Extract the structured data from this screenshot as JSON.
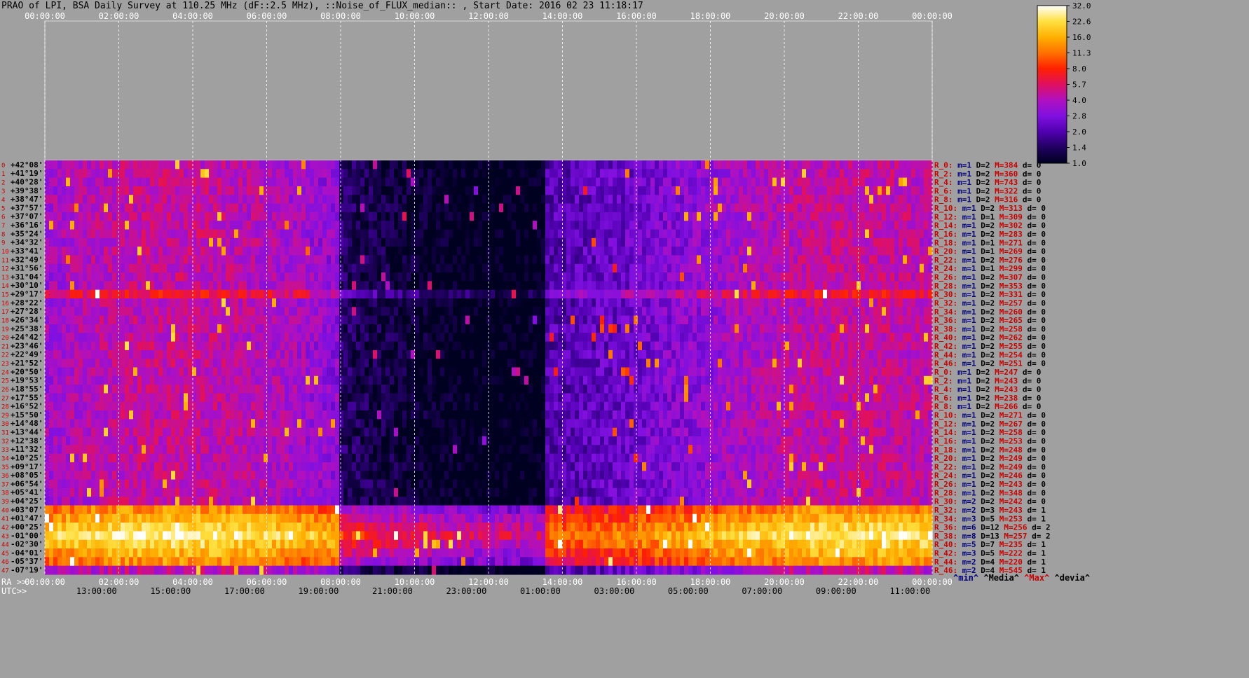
{
  "title": "PRAO of LPI, BSA Daily Survey at 110.25 MHz (dF::2.5 MHz), ::Noise_of_FLUX_median:: , Start Date: 2016 02 23 11:18:17",
  "chart_data": {
    "type": "heatmap",
    "top_axis_ticks": [
      "00:00:00",
      "02:00:00",
      "04:00:00",
      "06:00:00",
      "08:00:00",
      "10:00:00",
      "12:00:00",
      "14:00:00",
      "16:00:00",
      "18:00:00",
      "20:00:00",
      "22:00:00",
      "00:00:00"
    ],
    "ra_prefix": "RA >>",
    "ra_ticks": [
      "00:00:00",
      "02:00:00",
      "04:00:00",
      "06:00:00",
      "08:00:00",
      "10:00:00",
      "12:00:00",
      "14:00:00",
      "16:00:00",
      "18:00:00",
      "20:00:00",
      "22:00:00",
      "00:00:00"
    ],
    "utc_prefix": "UTC>>",
    "utc_ticks": [
      "13:00:00",
      "15:00:00",
      "17:00:00",
      "19:00:00",
      "21:00:00",
      "23:00:00",
      "01:00:00",
      "03:00:00",
      "05:00:00",
      "07:00:00",
      "09:00:00",
      "11:00:00"
    ],
    "declinations": [
      "+42°08'",
      "+41°19'",
      "+40°28'",
      "+39°38'",
      "+38°47'",
      "+37°57'",
      "+37°07'",
      "+36°16'",
      "+35°24'",
      "+34°32'",
      "+33°41'",
      "+32°49'",
      "+31°56'",
      "+31°04'",
      "+30°10'",
      "+29°17'",
      "+28°22'",
      "+27°28'",
      "+26°34'",
      "+25°38'",
      "+24°42'",
      "+23°46'",
      "+22°49'",
      "+21°52'",
      "+20°50'",
      "+19°53'",
      "+18°55'",
      "+17°55'",
      "+16°52'",
      "+15°50'",
      "+14°48'",
      "+13°44'",
      "+12°38'",
      "+11°32'",
      "+10°25'",
      "+09°17'",
      "+08°05'",
      "+06°54'",
      "+05°41'",
      "+04°25'",
      "+03°07'",
      "+01°47'",
      "+00°25'",
      "-01°00'",
      "-02°30'",
      "-04°01'",
      "-05°37'",
      "-07°19'"
    ],
    "row_stats": [
      {
        "r": "R_0:",
        "m": "m=1",
        "d": "D=2",
        "M": "M=384",
        "dv": "d= 0"
      },
      {
        "r": "R_2:",
        "m": "m=1",
        "d": "D=2",
        "M": "M=360",
        "dv": "d= 0"
      },
      {
        "r": "R_4:",
        "m": "m=1",
        "d": "D=2",
        "M": "M=743",
        "dv": "d= 0"
      },
      {
        "r": "R_6:",
        "m": "m=1",
        "d": "D=2",
        "M": "M=322",
        "dv": "d= 0"
      },
      {
        "r": "R_8:",
        "m": "m=1",
        "d": "D=2",
        "M": "M=316",
        "dv": "d= 0"
      },
      {
        "r": "R_10:",
        "m": "m=1",
        "d": "D=2",
        "M": "M=313",
        "dv": "d= 0"
      },
      {
        "r": "R_12:",
        "m": "m=1",
        "d": "D=1",
        "M": "M=309",
        "dv": "d= 0"
      },
      {
        "r": "R_14:",
        "m": "m=1",
        "d": "D=2",
        "M": "M=302",
        "dv": "d= 0"
      },
      {
        "r": "R_16:",
        "m": "m=1",
        "d": "D=2",
        "M": "M=283",
        "dv": "d= 0"
      },
      {
        "r": "R_18:",
        "m": "m=1",
        "d": "D=1",
        "M": "M=271",
        "dv": "d= 0"
      },
      {
        "r": "R_20:",
        "m": "m=1",
        "d": "D=1",
        "M": "M=269",
        "dv": "d= 0"
      },
      {
        "r": "R_22:",
        "m": "m=1",
        "d": "D=2",
        "M": "M=276",
        "dv": "d= 0"
      },
      {
        "r": "R_24:",
        "m": "m=1",
        "d": "D=1",
        "M": "M=299",
        "dv": "d= 0"
      },
      {
        "r": "R_26:",
        "m": "m=1",
        "d": "D=2",
        "M": "M=307",
        "dv": "d= 0"
      },
      {
        "r": "R_28:",
        "m": "m=1",
        "d": "D=2",
        "M": "M=353",
        "dv": "d= 0"
      },
      {
        "r": "R_30:",
        "m": "m=1",
        "d": "D=2",
        "M": "M=331",
        "dv": "d= 0"
      },
      {
        "r": "R_32:",
        "m": "m=1",
        "d": "D=2",
        "M": "M=257",
        "dv": "d= 0"
      },
      {
        "r": "R_34:",
        "m": "m=1",
        "d": "D=2",
        "M": "M=260",
        "dv": "d= 0"
      },
      {
        "r": "R_36:",
        "m": "m=1",
        "d": "D=2",
        "M": "M=265",
        "dv": "d= 0"
      },
      {
        "r": "R_38:",
        "m": "m=1",
        "d": "D=2",
        "M": "M=258",
        "dv": "d= 0"
      },
      {
        "r": "R_40:",
        "m": "m=1",
        "d": "D=2",
        "M": "M=262",
        "dv": "d= 0"
      },
      {
        "r": "R_42:",
        "m": "m=1",
        "d": "D=2",
        "M": "M=255",
        "dv": "d= 0"
      },
      {
        "r": "R_44:",
        "m": "m=1",
        "d": "D=2",
        "M": "M=254",
        "dv": "d= 0"
      },
      {
        "r": "R_46:",
        "m": "m=1",
        "d": "D=2",
        "M": "M=251",
        "dv": "d= 0"
      },
      {
        "r": "R_0:",
        "m": "m=1",
        "d": "D=2",
        "M": "M=247",
        "dv": "d= 0"
      },
      {
        "r": "R_2:",
        "m": "m=1",
        "d": "D=2",
        "M": "M=243",
        "dv": "d= 0"
      },
      {
        "r": "R_4:",
        "m": "m=1",
        "d": "D=2",
        "M": "M=243",
        "dv": "d= 0"
      },
      {
        "r": "R_6:",
        "m": "m=1",
        "d": "D=2",
        "M": "M=238",
        "dv": "d= 0"
      },
      {
        "r": "R_8:",
        "m": "m=1",
        "d": "D=2",
        "M": "M=266",
        "dv": "d= 0"
      },
      {
        "r": "R_10:",
        "m": "m=1",
        "d": "D=2",
        "M": "M=271",
        "dv": "d= 0"
      },
      {
        "r": "R_12:",
        "m": "m=1",
        "d": "D=2",
        "M": "M=267",
        "dv": "d= 0"
      },
      {
        "r": "R_14:",
        "m": "m=1",
        "d": "D=2",
        "M": "M=258",
        "dv": "d= 0"
      },
      {
        "r": "R_16:",
        "m": "m=1",
        "d": "D=2",
        "M": "M=253",
        "dv": "d= 0"
      },
      {
        "r": "R_18:",
        "m": "m=1",
        "d": "D=2",
        "M": "M=248",
        "dv": "d= 0"
      },
      {
        "r": "R_20:",
        "m": "m=1",
        "d": "D=2",
        "M": "M=249",
        "dv": "d= 0"
      },
      {
        "r": "R_22:",
        "m": "m=1",
        "d": "D=2",
        "M": "M=249",
        "dv": "d= 0"
      },
      {
        "r": "R_24:",
        "m": "m=1",
        "d": "D=2",
        "M": "M=246",
        "dv": "d= 0"
      },
      {
        "r": "R_26:",
        "m": "m=1",
        "d": "D=2",
        "M": "M=243",
        "dv": "d= 0"
      },
      {
        "r": "R_28:",
        "m": "m=1",
        "d": "D=2",
        "M": "M=348",
        "dv": "d= 0"
      },
      {
        "r": "R_30:",
        "m": "m=2",
        "d": "D=2",
        "M": "M=242",
        "dv": "d= 0"
      },
      {
        "r": "R_32:",
        "m": "m=2",
        "d": "D=3",
        "M": "M=243",
        "dv": "d= 1"
      },
      {
        "r": "R_34:",
        "m": "m=3",
        "d": "D=5",
        "M": "M=253",
        "dv": "d= 1"
      },
      {
        "r": "R_36:",
        "m": "m=6",
        "d": "D=12",
        "M": "M=256",
        "dv": "d= 2"
      },
      {
        "r": "R_38:",
        "m": "m=8",
        "d": "D=13",
        "M": "M=257",
        "dv": "d= 2"
      },
      {
        "r": "R_40:",
        "m": "m=5",
        "d": "D=7",
        "M": "M=235",
        "dv": "d= 1"
      },
      {
        "r": "R_42:",
        "m": "m=3",
        "d": "D=5",
        "M": "M=222",
        "dv": "d= 1"
      },
      {
        "r": "R_44:",
        "m": "m=2",
        "d": "D=4",
        "M": "M=220",
        "dv": "d= 1"
      },
      {
        "r": "R_46:",
        "m": "m=2",
        "d": "D=4",
        "M": "M=545",
        "dv": "d= 1"
      }
    ],
    "stats_legend": {
      "min": "^min^",
      "median": "^Media^",
      "max": "^Max^",
      "devia": "^devia^"
    },
    "colorbar_ticks": [
      "32.0",
      "22.6",
      "16.0",
      "11.3",
      "8.0",
      "5.7",
      "4.0",
      "2.8",
      "2.0",
      "1.4",
      "1.0"
    ],
    "colormap": [
      "#000020",
      "#200060",
      "#5000b0",
      "#8010e0",
      "#b010c0",
      "#e01060",
      "#ff2000",
      "#ff7000",
      "#ffb000",
      "#ffe040",
      "#ffffff"
    ],
    "colors": {
      "background": "#a0a0a0",
      "red_text": "#cc0000",
      "blue_text": "#000080",
      "white": "#ffffff"
    }
  }
}
